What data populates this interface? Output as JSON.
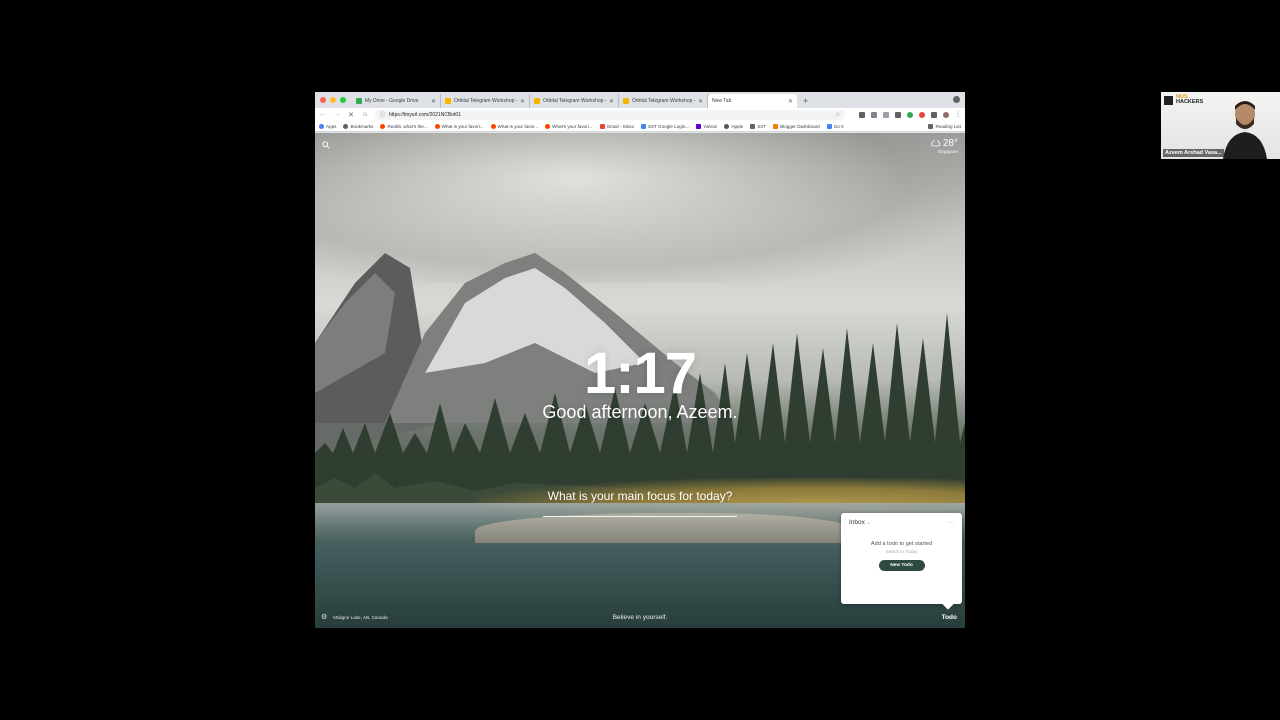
{
  "browser": {
    "tabs": [
      {
        "title": "My Drive - Google Drive",
        "favicon_color": "#34a853",
        "active": false
      },
      {
        "title": "Orbital Telegram Workshop - ...",
        "favicon_color": "#f4b400",
        "active": false
      },
      {
        "title": "Orbital Telegram Workshop - ...",
        "favicon_color": "#f4b400",
        "active": false
      },
      {
        "title": "Orbital Telegram Workshop - ...",
        "favicon_color": "#f4b400",
        "active": false
      },
      {
        "title": "New Tab",
        "favicon_color": "#ffffff",
        "active": true
      }
    ],
    "new_tab_symbol": "+",
    "address": "https://tinyurl.com/2021NCBot01",
    "bookmarks": [
      {
        "label": "Apps",
        "color": "#4285f4"
      },
      {
        "label": "Bookmarks",
        "color": "#5f6368"
      },
      {
        "label": "Reddit, what's the...",
        "color": "#ff4500"
      },
      {
        "label": "What is your favori...",
        "color": "#ff4500"
      },
      {
        "label": "What is your favor...",
        "color": "#ff4500"
      },
      {
        "label": "What's your favori...",
        "color": "#ff4500"
      },
      {
        "label": "Gmail - Inbox",
        "color": "#ea4335"
      },
      {
        "label": "SST Google Login...",
        "color": "#4285f4"
      },
      {
        "label": "Yahoo!",
        "color": "#6001d2"
      },
      {
        "label": "Apple",
        "color": "#555555"
      },
      {
        "label": "SST",
        "color": "#5f6368"
      },
      {
        "label": "Blogger Dashboard",
        "color": "#f57d00"
      },
      {
        "label": "Go It",
        "color": "#4285f4"
      }
    ],
    "reading_list": "Reading List"
  },
  "momentum": {
    "weather": {
      "temp": "28°",
      "location": "Singapore"
    },
    "time": "1:17",
    "greeting": "Good afternoon, Azeem.",
    "focus_question": "What is your main focus for today?",
    "photo_location": "Maligne Lake, AB, Canada",
    "quote": "Believe in yourself.",
    "todo_link": "Todo",
    "todo_panel": {
      "list_name": "Inbox",
      "more": "···",
      "empty_message": "Add a todo to get started",
      "switch_hint": "Switch to Today",
      "new_button": "New Todo"
    }
  },
  "webcam": {
    "logo_line1": "NUS",
    "logo_line2": "HACKERS",
    "name": "Azeem Arshad Vasa..."
  }
}
